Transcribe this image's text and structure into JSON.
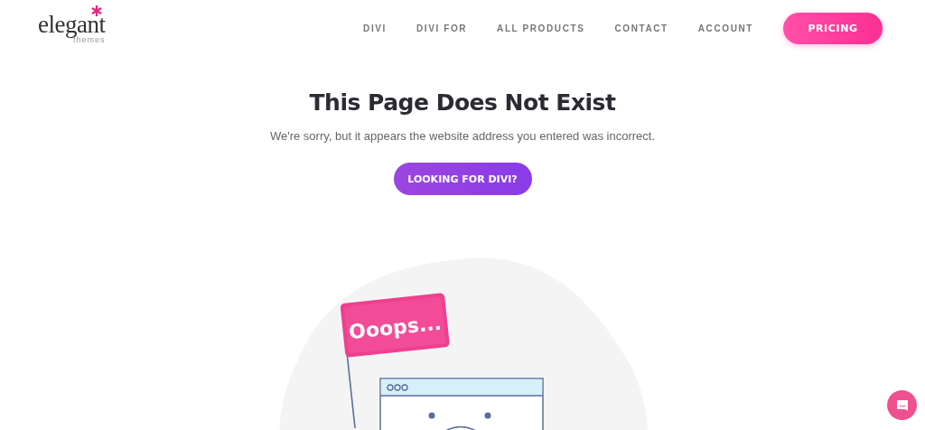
{
  "header": {
    "logo": {
      "word": "elegant",
      "tagline": "themes"
    },
    "nav": [
      {
        "label": "DIVI",
        "kind": "link"
      },
      {
        "label": "DIVI FOR",
        "kind": "link"
      },
      {
        "label": "ALL PRODUCTS",
        "kind": "link"
      },
      {
        "label": "CONTACT",
        "kind": "link"
      },
      {
        "label": "ACCOUNT",
        "kind": "link"
      },
      {
        "label": "PRICING",
        "kind": "button"
      }
    ]
  },
  "main": {
    "title": "This Page Does Not Exist",
    "message": "We're sorry, but it appears the website address you entered was incorrect.",
    "button": "LOOKING FOR DIVI?",
    "illustration": {
      "flag_text": "Ooops..."
    }
  }
}
